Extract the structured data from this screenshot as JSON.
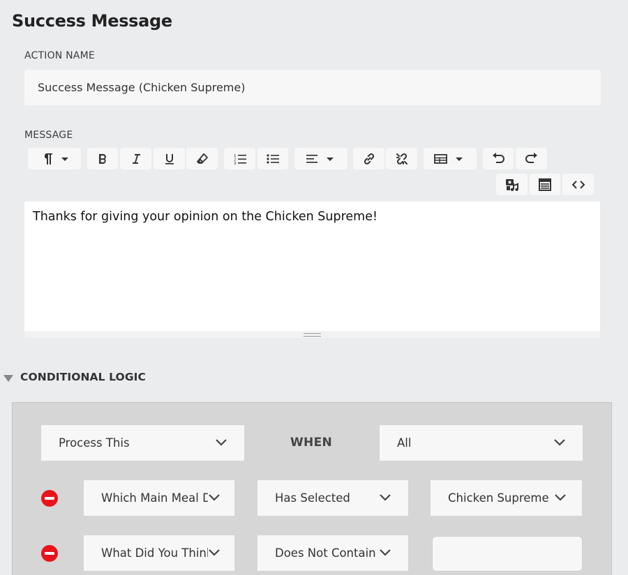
{
  "page": {
    "title": "Success Message"
  },
  "action_name": {
    "label": "ACTION NAME",
    "value": "Success Message (Chicken Supreme)"
  },
  "message": {
    "label": "MESSAGE",
    "body": "Thanks for giving your opinion on the Chicken Supreme!",
    "toolbar": [
      "paragraph-format-icon",
      "bold-icon",
      "italic-icon",
      "underline-icon",
      "clear-formatting-icon",
      "ordered-list-icon",
      "unordered-list-icon",
      "align-icon",
      "insert-link-icon",
      "unlink-icon",
      "insert-table-icon",
      "undo-icon",
      "redo-icon",
      "insert-media-icon",
      "form-fields-icon",
      "code-view-icon"
    ]
  },
  "conditional_logic": {
    "heading": "CONDITIONAL LOGIC",
    "action_select": "Process This",
    "when_label": "WHEN",
    "match_select": "All",
    "rules": [
      {
        "field": "Which Main Meal Di",
        "operator": "Has Selected",
        "value": "Chicken Supreme"
      },
      {
        "field": "What Did You Think",
        "operator": "Does Not Contain",
        "value": ""
      }
    ]
  },
  "colors": {
    "background": "#ebecee",
    "panel": "#d6d6d6",
    "remove_button": "#e8141b"
  }
}
